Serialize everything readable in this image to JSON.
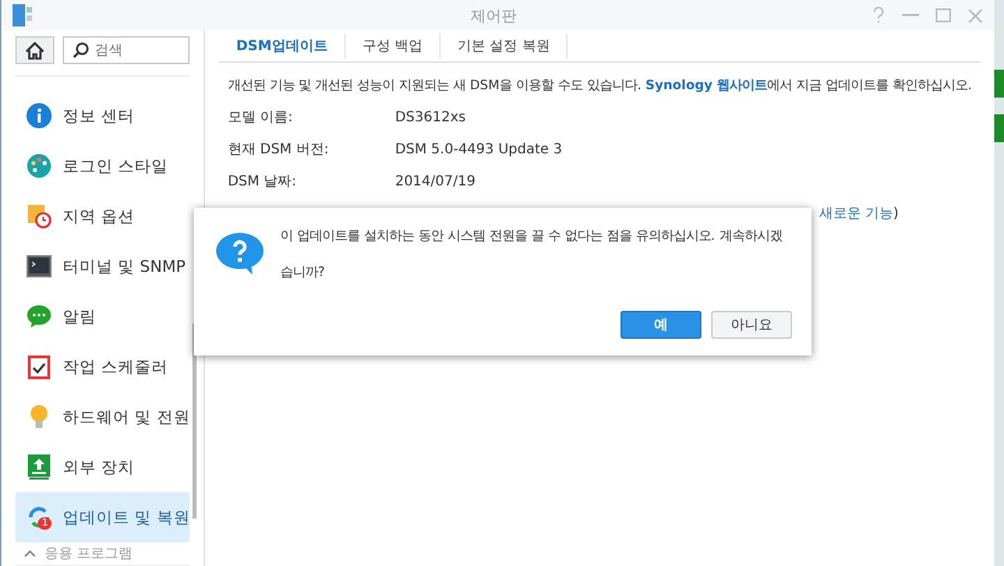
{
  "window": {
    "title": "제어판"
  },
  "search": {
    "placeholder": "검색"
  },
  "sidebar": {
    "items": [
      {
        "label": "정보 센터",
        "selected": false
      },
      {
        "label": "로그인 스타일",
        "selected": false
      },
      {
        "label": "지역 옵션",
        "selected": false
      },
      {
        "label": "터미널 및 SNMP",
        "selected": false
      },
      {
        "label": "알림",
        "selected": false
      },
      {
        "label": "작업 스케줄러",
        "selected": false
      },
      {
        "label": "하드웨어 및 전원",
        "selected": false
      },
      {
        "label": "외부 장치",
        "selected": false
      },
      {
        "label": "업데이트 및 복원",
        "selected": true,
        "badge": "1"
      }
    ],
    "section": {
      "label": "응용 프로그램",
      "expanded": true
    }
  },
  "tabs": [
    {
      "label": "DSM업데이트",
      "selected": true
    },
    {
      "label": "구성 백업",
      "selected": false
    },
    {
      "label": "기본 설정 복원",
      "selected": false
    }
  ],
  "intro": {
    "before": "개선된 기능 및 개선된 성능이 지원되는 새 DSM을 이용할 수도 있습니다. ",
    "link": "Synology 웹사이트",
    "after": "에서 지금 업데이트를 확인하십시오."
  },
  "fields": [
    {
      "label": "모델 이름:",
      "value": "DS3612xs"
    },
    {
      "label": "현재 DSM 버전:",
      "value": "DSM 5.0-4493 Update 3"
    },
    {
      "label": "DSM 날짜:",
      "value": "2014/07/19"
    }
  ],
  "partial_line": {
    "link": "새로운 기능",
    "after": ")"
  },
  "dialog": {
    "message": "이 업데이트를 설치하는 동안 시스템 전원을 끌 수 없다는 점을 유의하십시오. 계속하시겠습니까?",
    "buttons": [
      {
        "label": "예",
        "primary": true
      },
      {
        "label": "아니요",
        "primary": false
      }
    ]
  }
}
